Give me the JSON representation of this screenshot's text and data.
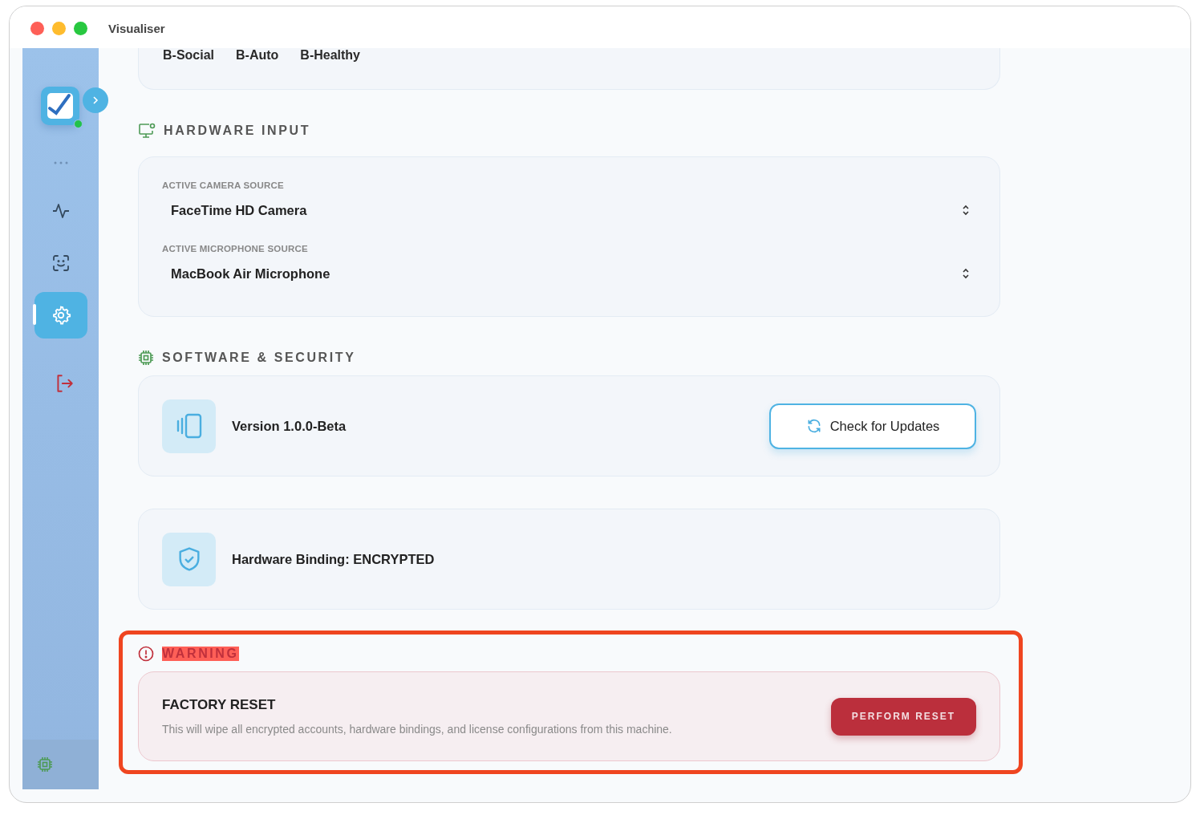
{
  "window": {
    "title": "Visualiser"
  },
  "sidebar": {
    "online": true,
    "items": [
      {
        "kind": "more",
        "selected": false
      },
      {
        "kind": "activity",
        "selected": false
      },
      {
        "kind": "face-scan",
        "selected": false
      },
      {
        "kind": "settings",
        "selected": true
      },
      {
        "kind": "logout",
        "selected": false
      }
    ]
  },
  "top_card": {
    "tags": [
      "B-Social",
      "B-Auto",
      "B-Healthy"
    ]
  },
  "hardware_input": {
    "title": "HARDWARE INPUT",
    "fields": [
      {
        "label": "ACTIVE CAMERA SOURCE",
        "value": "FaceTime HD Camera"
      },
      {
        "label": "ACTIVE MICROPHONE SOURCE",
        "value": "MacBook Air Microphone"
      }
    ]
  },
  "software_security": {
    "title": "SOFTWARE & SECURITY",
    "version": "Version 1.0.0-Beta",
    "update_button": "Check for Updates",
    "binding": "Hardware Binding: ENCRYPTED"
  },
  "warning": {
    "title": "WARNING",
    "highlighted": true,
    "reset_title": "FACTORY RESET",
    "description": "This will wipe all encrypted accounts, hardware bindings, and license configurations from this machine.",
    "button": "PERFORM RESET"
  }
}
